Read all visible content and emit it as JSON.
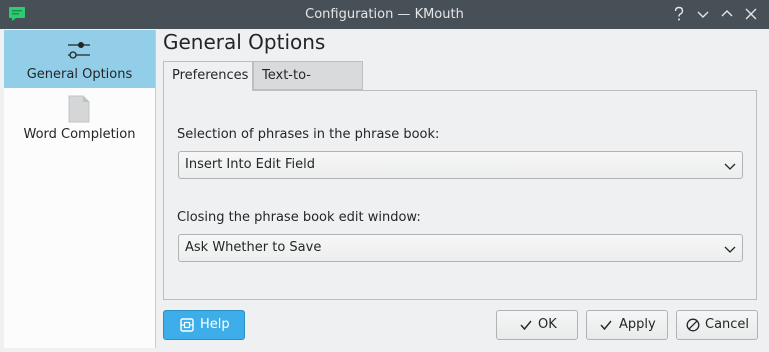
{
  "window": {
    "title": "Configuration — KMouth"
  },
  "sidebar": {
    "items": [
      {
        "label": "General Options",
        "icon": "sliders-icon",
        "selected": true
      },
      {
        "label": "Word Completion",
        "icon": "document-icon",
        "selected": false
      }
    ]
  },
  "page": {
    "title": "General Options"
  },
  "tabs": [
    {
      "label": "Preferences",
      "active": true
    },
    {
      "label": "Text-to-Speech",
      "active": false
    }
  ],
  "form": {
    "selection_label": "Selection of phrases in the phrase book:",
    "selection_value": "Insert Into Edit Field",
    "closing_label": "Closing the phrase book edit window:",
    "closing_value": "Ask Whether to Save"
  },
  "buttons": {
    "help": "Help",
    "ok": "OK",
    "apply": "Apply",
    "cancel": "Cancel"
  },
  "colors": {
    "titlebar": "#475057",
    "selection": "#93cee9",
    "accent": "#3daee9"
  }
}
